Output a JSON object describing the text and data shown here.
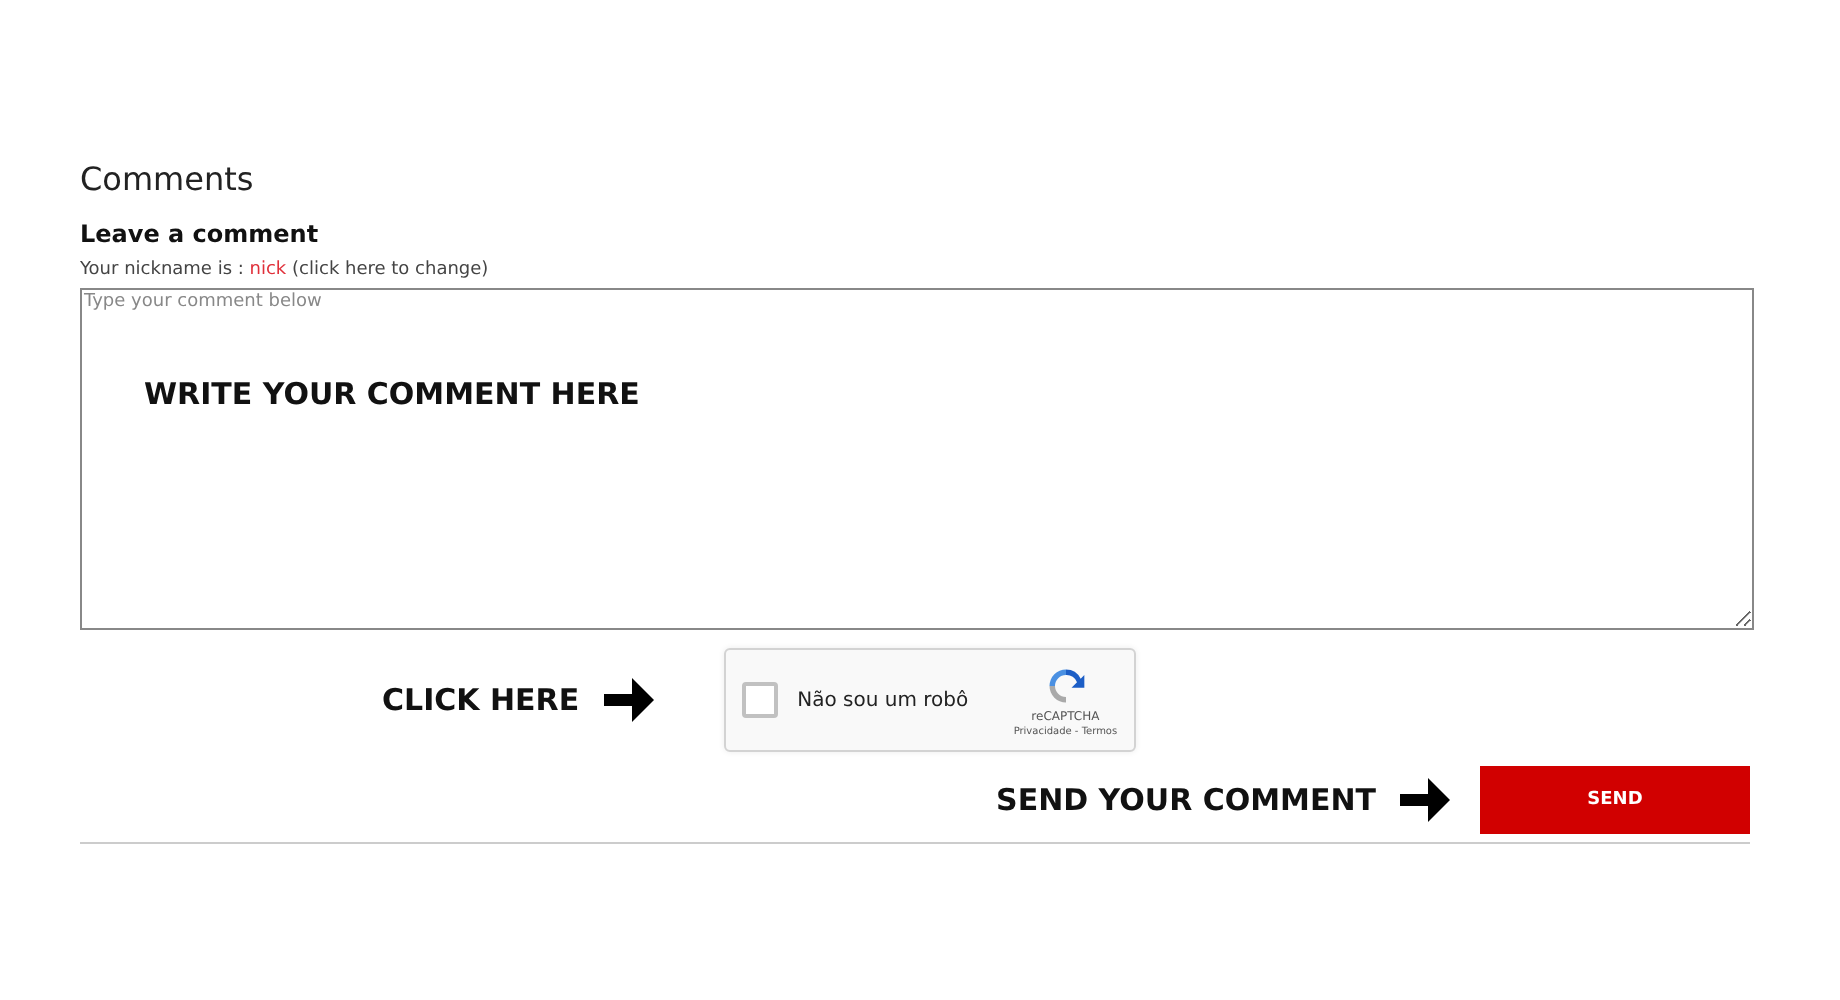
{
  "section_title": "Comments",
  "form": {
    "heading": "Leave a comment",
    "nickname": {
      "prefix": "Your nickname is : ",
      "name": "nick",
      "link": "(click here to change)"
    },
    "comment": {
      "placeholder": "Type your comment below"
    },
    "captcha": {
      "checked": false,
      "label": "Não sou um robô",
      "brand": "reCAPTCHA",
      "links": "Privacidade - Termos"
    },
    "send_button": "SEND"
  },
  "annotations": [
    {
      "kind": "overlay",
      "text": "WRITE YOUR COMMENT HERE"
    },
    {
      "kind": "arrow",
      "text": "CLICK HERE"
    },
    {
      "kind": "arrow",
      "text": "SEND YOUR COMMENT"
    }
  ]
}
